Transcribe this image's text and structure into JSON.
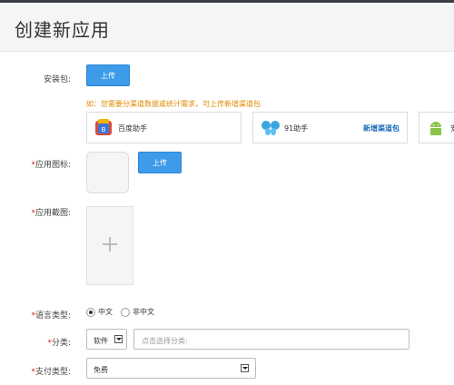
{
  "header": {
    "title": "创建新应用"
  },
  "form": {
    "package": {
      "label": "安装包:",
      "upload": "上传"
    },
    "hint": "如：您需要分渠道数据或统计需求，可上传新增渠道包",
    "stores": [
      {
        "name": "百度助手"
      },
      {
        "name": "91助手",
        "extra": "新增渠道包"
      },
      {
        "name": "安"
      }
    ],
    "icon": {
      "required": "*",
      "label": "应用图标:",
      "upload": "上传"
    },
    "screenshot": {
      "required": "*",
      "label": "应用截图:"
    },
    "language": {
      "required": "*",
      "label": "语言类型:",
      "options": [
        "中文",
        "非中文"
      ],
      "selected": "中文"
    },
    "category": {
      "required": "*",
      "label": "分类:",
      "value": "软件",
      "placeholder": "点击选择分类:"
    },
    "payment": {
      "required": "*",
      "label": "支付类型:",
      "value": "免费"
    }
  }
}
